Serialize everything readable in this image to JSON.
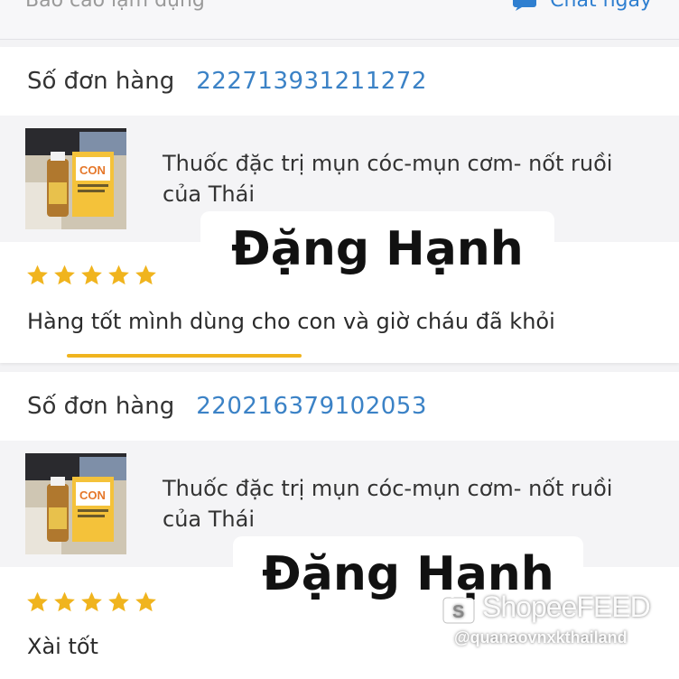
{
  "header": {
    "report_label": "Báo cáo lạm dụng",
    "chat_label": "Chat ngay",
    "chat_icon": "chat-bubble-icon"
  },
  "colors": {
    "link_blue": "#3b82c6",
    "star_yellow": "#f0b41e",
    "accent_underline": "#f0b41e"
  },
  "reviews": [
    {
      "order_label": "Số đơn hàng",
      "order_number": "222713931211272",
      "product_name": "Thuốc đặc trị mụn cóc-mụn cơm- nốt ruồi của Thái",
      "rating": 5,
      "review_text": "Hàng tốt mình dùng cho con và giờ cháu đã khỏi",
      "overlay_name": "Đặng Hạnh"
    },
    {
      "order_label": "Số đơn hàng",
      "order_number": "220216379102053",
      "product_name": "Thuốc đặc trị mụn cóc-mụn cơm- nốt ruồi của Thái",
      "rating": 5,
      "review_text": "Xài tốt",
      "overlay_name": "Đặng Hạnh"
    }
  ],
  "watermark": {
    "brand": "ShopeeFEED",
    "handle": "@quanaovnxkthailand"
  }
}
